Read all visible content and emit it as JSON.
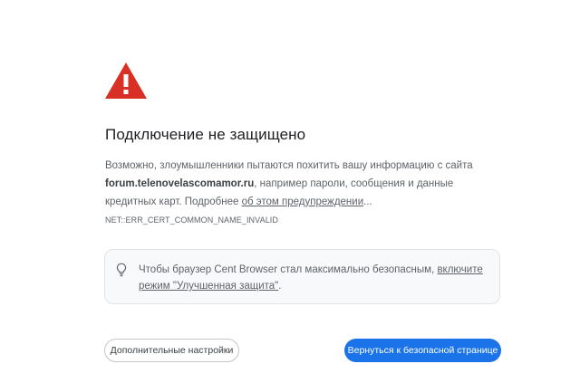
{
  "colors": {
    "warning": "#d93025",
    "primary_button": "#1a73e8",
    "text_secondary": "#5f6368",
    "tip_background": "#f8f9fa"
  },
  "icons": {
    "warning": "warning-triangle-icon",
    "tip": "lightbulb-icon"
  },
  "title": "Подключение не защищено",
  "description": {
    "prefix": "Возможно, злоумышленники пытаются похитить вашу информацию с сайта",
    "domain": "forum.telenovelascomamor.ru",
    "middle": ", например пароли, сообщения и данные кредитных карт. Подробнее ",
    "link": "об этом предупреждении",
    "suffix": "..."
  },
  "error_code": "NET::ERR_CERT_COMMON_NAME_INVALID",
  "tip": {
    "text": "Чтобы браузер Cent Browser стал максимально безопасным, ",
    "link": "включите режим \"Улучшенная защита\"",
    "suffix": "."
  },
  "buttons": {
    "advanced": "Дополнительные настройки",
    "back": "Вернуться к безопасной странице"
  }
}
